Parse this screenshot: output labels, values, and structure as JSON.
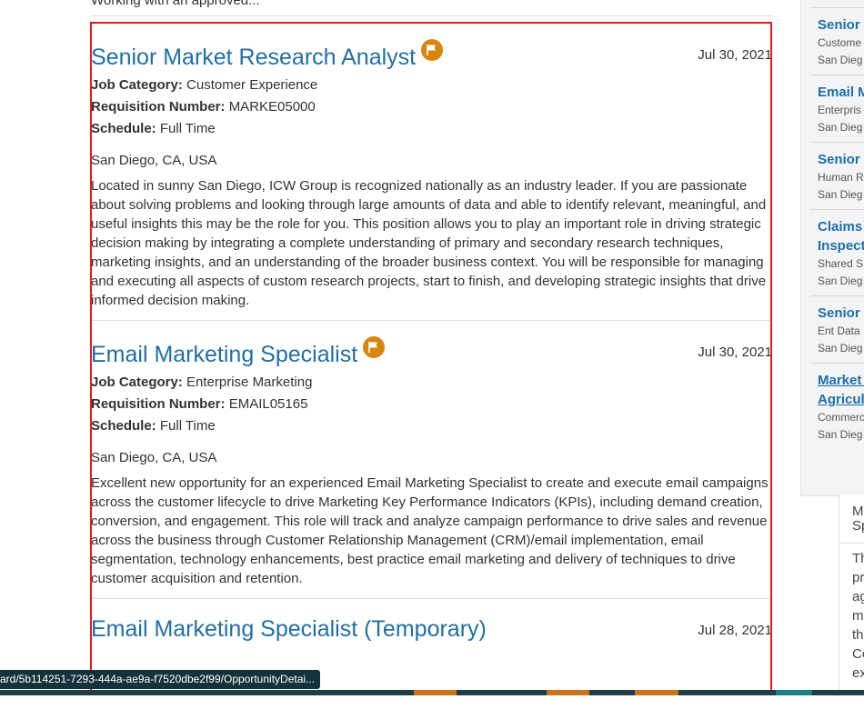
{
  "top_partial_text": "Working with an approved...",
  "jobs": [
    {
      "title": "Senior Market Research Analyst",
      "flagged": true,
      "date": "Jul 30, 2021",
      "category_label": "Job Category:",
      "category": "Customer Experience",
      "req_label": "Requisition Number:",
      "requisition": "MARKE05000",
      "schedule_label": "Schedule:",
      "schedule": "Full Time",
      "location": "San Diego, CA, USA",
      "description": "Located in sunny San Diego, ICW Group is recognized nationally as an industry leader. If you are passionate about solving problems and looking through large amounts of data and able to identify relevant, meaningful, and useful insights this may be the role for you. This position allows you to play an important role in driving strategic decision making by integrating a complete understanding of primary and secondary research techniques, marketing insights, and an understanding of the broader business context. You will be responsible for managing and executing all aspects of custom research projects, start to finish, and developing strategic insights that drive informed decision making."
    },
    {
      "title": "Email Marketing Specialist",
      "flagged": true,
      "date": "Jul 30, 2021",
      "category_label": "Job Category:",
      "category": "Enterprise Marketing",
      "req_label": "Requisition Number:",
      "requisition": "EMAIL05165",
      "schedule_label": "Schedule:",
      "schedule": "Full Time",
      "location": "San Diego, CA, USA",
      "description": "Excellent new opportunity for an experienced Email Marketing Specialist to create and execute email campaigns across the customer lifecycle to drive Marketing Key Performance Indicators (KPIs), including demand creation, conversion, and engagement. This role will track and analyze campaign performance to drive sales and revenue across the business through Customer Relationship Management (CRM)/email implementation, email segmentation, technology enhancements, best practice email marketing and delivery of techniques to drive customer acquisition and retention."
    },
    {
      "title": "Email Marketing Specialist (Temporary)",
      "date": "Jul 28, 2021"
    }
  ],
  "sidebar": {
    "items": [
      {
        "title": "Senior M",
        "sub1": "Custome",
        "sub2": "San Dieg"
      },
      {
        "title": "Email M",
        "sub1": "Enterpris",
        "sub2": "San Dieg"
      },
      {
        "title": "Senior T",
        "sub1": "Human R",
        "sub2": "San Dieg"
      },
      {
        "title": "Claims I",
        "title2": "Inspecto",
        "sub1": "Shared S",
        "sub2": "San Dieg"
      },
      {
        "title": "Senior D",
        "sub1": "Ent Data",
        "sub2": "San Dieg"
      },
      {
        "title": "Market S",
        "title2": "Agricult",
        "sub1": "Commerci",
        "sub2": "San Dieg"
      }
    ]
  },
  "side_card": {
    "header_l1": "M",
    "header_l2": "Sp",
    "lines": [
      "Th",
      "pr",
      "ag",
      "m",
      "th",
      "Co",
      "ex"
    ]
  },
  "status_url": "ard/5b114251-7293-444a-ae9a-f7520dbe2f99/OpportunityDetai...",
  "colors": {
    "link": "#1f6fa8",
    "flag": "#d9860f",
    "highlight": "#e0201c",
    "footer": "#1f3d44"
  }
}
